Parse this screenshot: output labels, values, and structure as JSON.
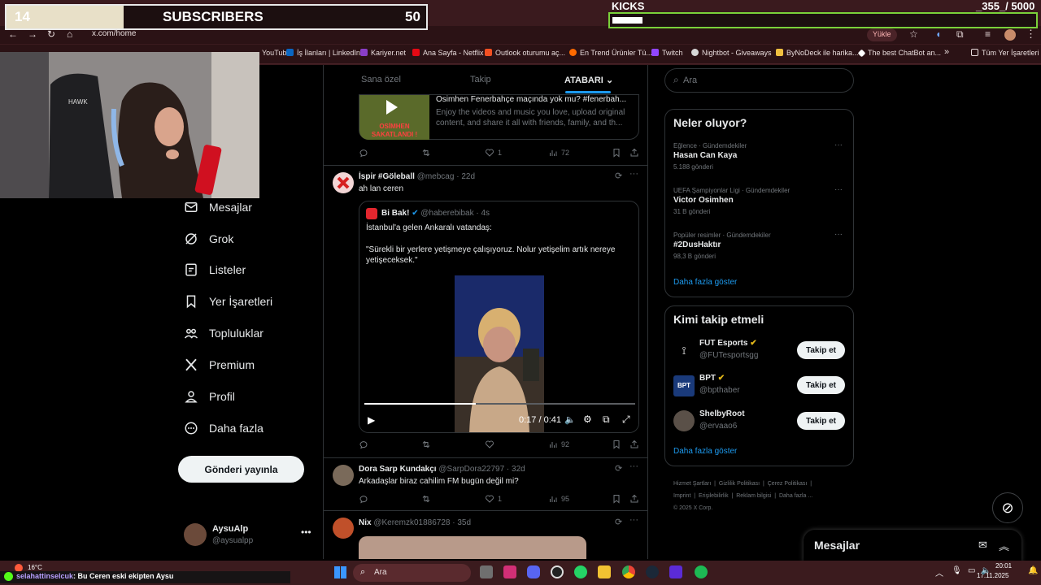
{
  "overlays": {
    "subscribers_current": "14",
    "subscribers_label": "SUBSCRIBERS",
    "subscribers_goal": "50",
    "subscribers_progress": 0.28,
    "kicks_label": "KICKS",
    "kicks_count": "_355_/ 5000",
    "kicks_progress": 0.071
  },
  "browser": {
    "url": "x.com/home",
    "upload_label": "Yükle",
    "bookmarks": [
      "YouTube",
      "İş İlanları | LinkedIn",
      "Kariyer.net",
      "Ana Sayfa - Netflix",
      "Outlook oturumu aç...",
      "En Trend Ürünler Tü...",
      "Twitch",
      "Nightbot - Giveaways",
      "ByNoDeck ile harika...",
      "The best ChatBot an..."
    ],
    "all_bookmarks": "Tüm Yer İşaretleri",
    "colors": {
      "chrome": "#3a1a1e",
      "accent": "#1d9bf0",
      "verified_gold": "#e2b719"
    }
  },
  "feed_tabs": {
    "for_you": "Sana özel",
    "following": "Takip",
    "active": "ATABARI"
  },
  "nav": {
    "messages": "Mesajlar",
    "grok": "Grok",
    "lists": "Listeler",
    "bookmarks": "Yer İşaretleri",
    "communities": "Topluluklar",
    "premium": "Premium",
    "profile": "Profil",
    "more": "Daha fazla",
    "post_button": "Gönderi yayınla",
    "user_name": "AysuAlp",
    "user_handle": "@aysualpp"
  },
  "tweet_top": {
    "link_title": "Osimhen Fenerbahçe maçında yok mu? #fenerbah...",
    "link_desc": "Enjoy the videos and music you love, upload original content, and share it all with friends, family, and th...",
    "thumb_caption": "OSİMHEN SAKATLANDI !",
    "likes": "1",
    "views": "72"
  },
  "tweet1": {
    "name": "İspir #Göleball",
    "handle": "@mebcag",
    "time": "· 22d",
    "text": "ah lan ceren",
    "quote_name": "Bi Bak!",
    "quote_handle": "@haberebibak",
    "quote_time": "· 4s",
    "quote_line1": "İstanbul'a gelen Ankaralı vatandaş:",
    "quote_line2": "\"Sürekli bir yerlere yetişmeye çalışıyoruz. Nolur yetişelim artık nereye yetişeceksek.\"",
    "video_time": "0:17 / 0:41",
    "video_progress": 0.41,
    "views": "92"
  },
  "tweet2": {
    "name": "Dora Sarp Kundakçı",
    "handle": "@SarpDora22797",
    "time": "· 32d",
    "text": "Arkadaşlar biraz cahilim FM bugün değil mi?",
    "likes": "1",
    "views": "95"
  },
  "tweet3": {
    "name": "Nix",
    "handle": "@Keremzk01886728",
    "time": "· 35d"
  },
  "search": {
    "placeholder": "Ara"
  },
  "trends": {
    "title": "Neler oluyor?",
    "items": [
      {
        "context": "Eğlence · Gündemdekiler",
        "name": "Hasan Can Kaya",
        "count": "5.188 gönderi"
      },
      {
        "context": "UEFA Şampiyonlar Ligi · Gündemdekiler",
        "name": "Victor Osimhen",
        "count": "31 B gönderi"
      },
      {
        "context": "Popüler resimler · Gündemdekiler",
        "name": "#2DusHaktır",
        "count": "98,3 B gönderi"
      }
    ],
    "show_more": "Daha fazla göster"
  },
  "who_to_follow": {
    "title": "Kimi takip etmeli",
    "items": [
      {
        "name": "FUT Esports",
        "handle": "@FUTesportsgg"
      },
      {
        "name": "BPT",
        "handle": "@bpthaber"
      },
      {
        "name": "ShelbyRoot",
        "handle": "@ervaao6"
      }
    ],
    "follow_label": "Takip et",
    "show_more": "Daha fazla göster"
  },
  "footer": {
    "line1": [
      "Hizmet Şartları",
      "Gizlilik Politikası",
      "Çerez Politikası"
    ],
    "line2": [
      "Imprint",
      "Erişilebilirlik",
      "Reklam bilgisi",
      "Daha fazla ..."
    ],
    "copyright": "© 2025 X Corp."
  },
  "messages_drawer": {
    "title": "Mesajlar"
  },
  "chat": {
    "user": "selahattinselcuk",
    "message": ": Bu Ceren eski ekipten Aysu"
  },
  "taskbar": {
    "weather": "16°C",
    "search": "Ara",
    "time": "20:01",
    "date": "17.11.2025"
  }
}
